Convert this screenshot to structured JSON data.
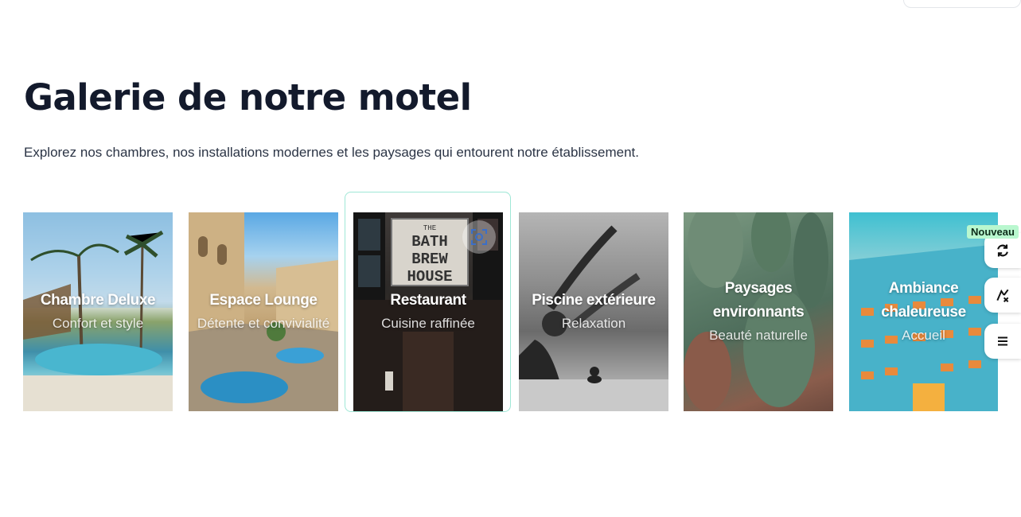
{
  "heading": {
    "title": "Galerie de notre motel",
    "subtitle": "Explorez nos chambres, nos installations modernes et les paysages qui entourent notre établissement."
  },
  "gallery": [
    {
      "title": "Chambre Deluxe",
      "subtitle": "Confort et style",
      "icon": "tropical-pool-photo"
    },
    {
      "title": "Espace Lounge",
      "subtitle": "Détente et convivialité",
      "icon": "courtyard-fountain-photo"
    },
    {
      "title": "Restaurant",
      "subtitle": "Cuisine raffinée",
      "icon": "restaurant-storefront-photo"
    },
    {
      "title": "Piscine extérieure",
      "subtitle": "Relaxation",
      "icon": "yoga-stretch-photo"
    },
    {
      "title": "Paysages environnants",
      "subtitle": "Beauté naturelle",
      "icon": "cactus-photo"
    },
    {
      "title": "Ambiance chaleureuse",
      "subtitle": "Accueil",
      "icon": "colorful-building-photo"
    }
  ],
  "restaurant_sign": [
    "THE",
    "BATH",
    "BREW",
    "HOUSE"
  ],
  "side_tools": {
    "badge": "Nouveau",
    "buttons": [
      "refresh-icon",
      "draw-icon",
      "menu-icon"
    ]
  },
  "colors": {
    "title": "#131a2c",
    "accent_frame": "#9fe7d6",
    "badge_bg": "#b9f7cf"
  }
}
